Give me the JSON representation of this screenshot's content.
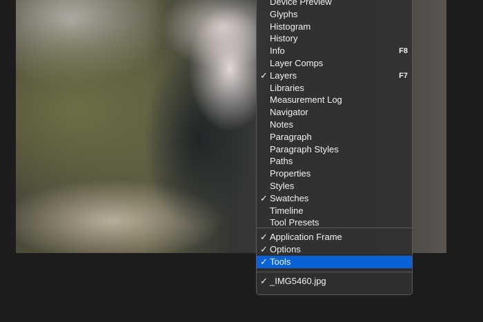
{
  "photo": {
    "description_icon": "image"
  },
  "menu": {
    "groups": [
      [
        {
          "label": "Device Preview",
          "checked": false
        },
        {
          "label": "Glyphs",
          "checked": false
        },
        {
          "label": "Histogram",
          "checked": false
        },
        {
          "label": "History",
          "checked": false
        },
        {
          "label": "Info",
          "checked": false,
          "shortcut": "F8"
        },
        {
          "label": "Layer Comps",
          "checked": false
        },
        {
          "label": "Layers",
          "checked": true,
          "shortcut": "F7"
        },
        {
          "label": "Libraries",
          "checked": false
        },
        {
          "label": "Measurement Log",
          "checked": false
        },
        {
          "label": "Navigator",
          "checked": false
        },
        {
          "label": "Notes",
          "checked": false
        },
        {
          "label": "Paragraph",
          "checked": false
        },
        {
          "label": "Paragraph Styles",
          "checked": false
        },
        {
          "label": "Paths",
          "checked": false
        },
        {
          "label": "Properties",
          "checked": false
        },
        {
          "label": "Styles",
          "checked": false
        },
        {
          "label": "Swatches",
          "checked": true
        },
        {
          "label": "Timeline",
          "checked": false
        },
        {
          "label": "Tool Presets",
          "checked": false
        }
      ],
      [
        {
          "label": "Application Frame",
          "checked": true
        },
        {
          "label": "Options",
          "checked": true
        },
        {
          "label": "Tools",
          "checked": true,
          "highlighted": true
        }
      ],
      [
        {
          "label": "_IMG5460.jpg",
          "checked": true
        }
      ]
    ],
    "check_glyph": "✓",
    "highlight_color": "#0a63d6"
  }
}
